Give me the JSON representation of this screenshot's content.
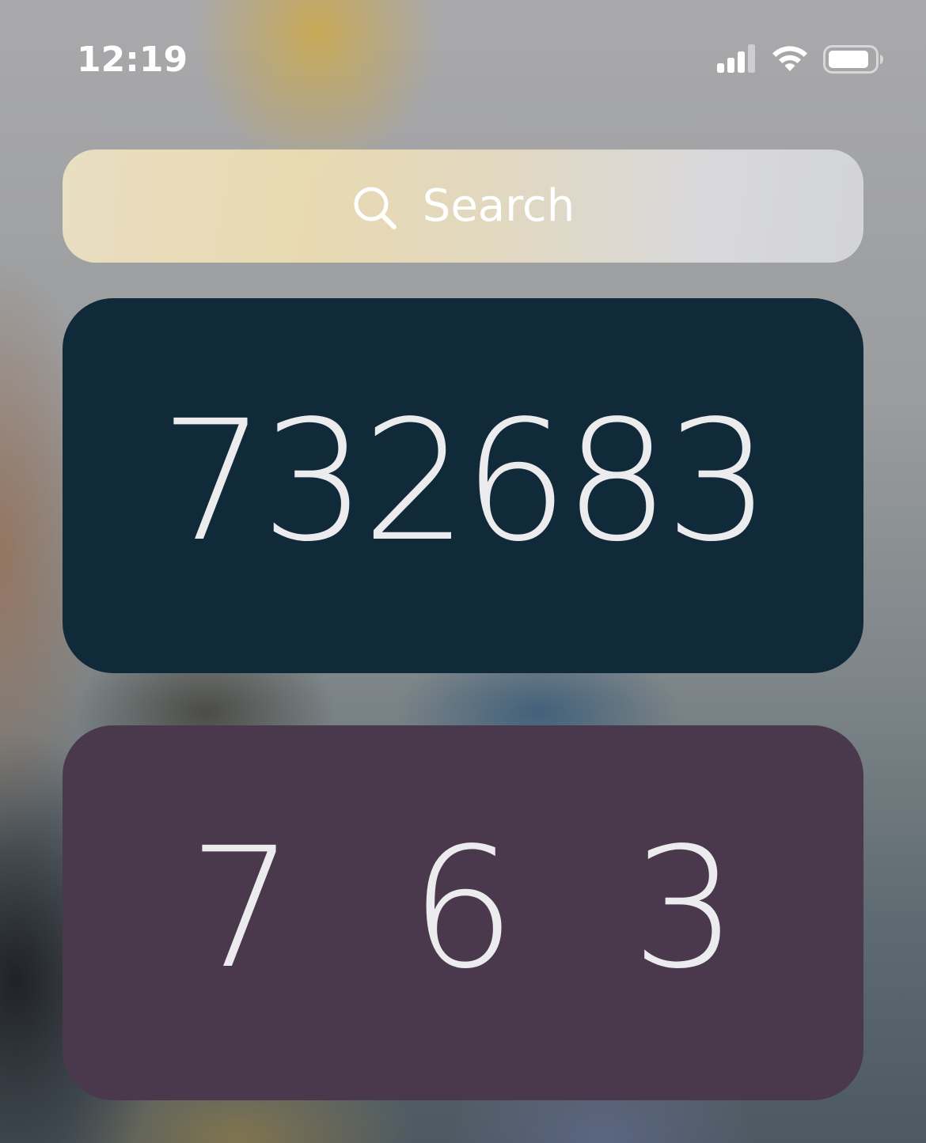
{
  "status_bar": {
    "time": "12:19",
    "icons": [
      "signal-icon",
      "wifi-icon",
      "battery-icon"
    ]
  },
  "search": {
    "placeholder": "Search",
    "icon": "search-icon"
  },
  "widgets": [
    {
      "value": "732683",
      "background": "#112a39"
    },
    {
      "digits": [
        "7",
        "6",
        "3"
      ],
      "background": "#4a394c"
    }
  ],
  "colors": {
    "text": "#ececef"
  }
}
